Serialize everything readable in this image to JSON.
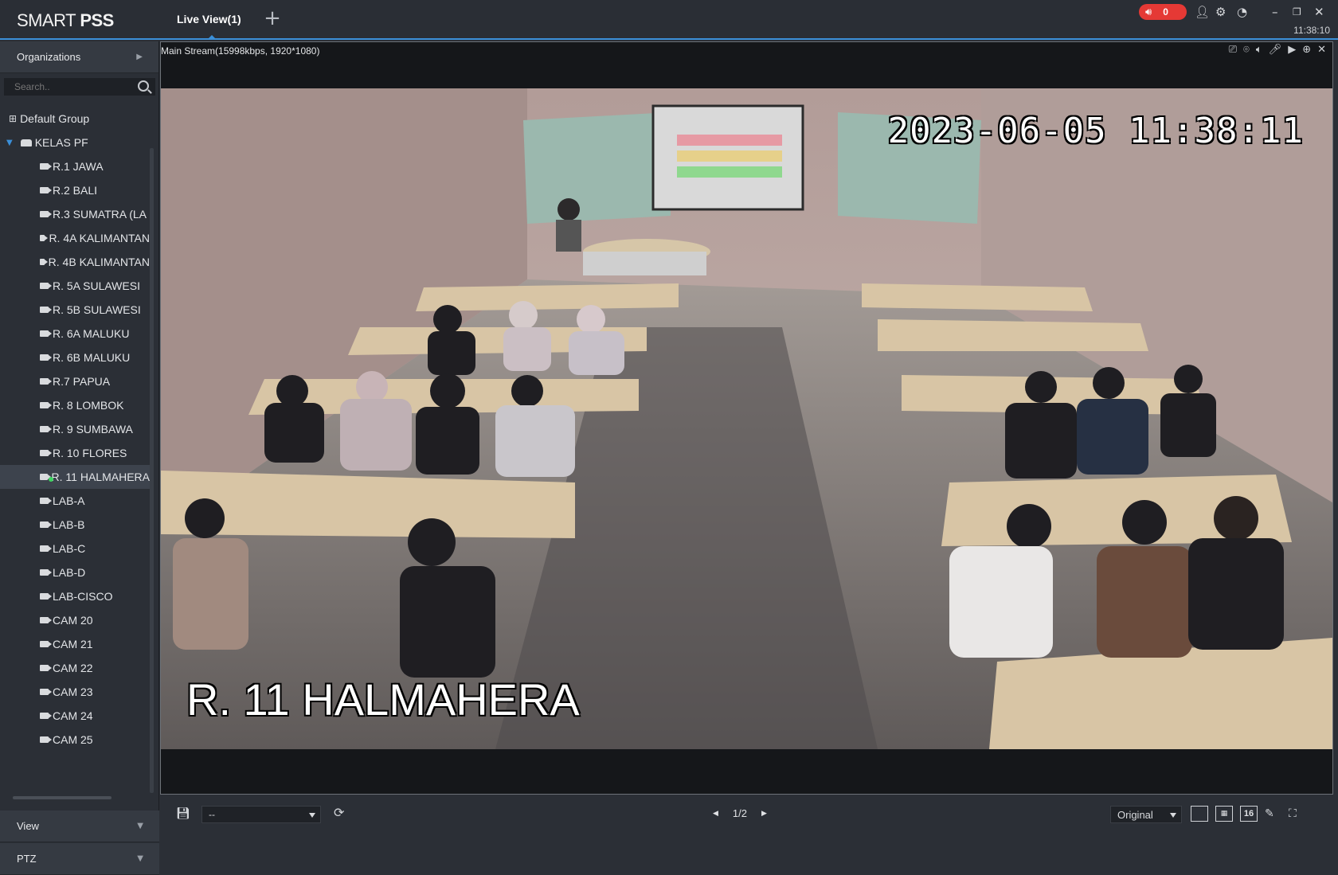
{
  "app": {
    "logo_light": "SMART ",
    "logo_bold": "PSS",
    "clock": "11:38:10"
  },
  "tabs": [
    {
      "label": "Live View(1)"
    }
  ],
  "alarm": {
    "count": "0"
  },
  "sidebar": {
    "organizations_label": "Organizations",
    "search_placeholder": "Search..",
    "root": "Default Group",
    "group": "KELAS PF",
    "devices": [
      "R.1 JAWA",
      "R.2 BALI",
      "R.3 SUMATRA (LA",
      "R. 4A KALIMANTAN",
      "R. 4B KALIMANTAN",
      "R. 5A SULAWESI",
      "R. 5B SULAWESI",
      "R. 6A MALUKU",
      "R. 6B MALUKU",
      "R.7 PAPUA",
      "R. 8 LOMBOK",
      "R. 9 SUMBAWA",
      "R. 10 FLORES",
      "R. 11 HALMAHERA",
      "LAB-A",
      "LAB-B",
      "LAB-C",
      "LAB-D",
      "LAB-CISCO",
      "CAM 20",
      "CAM 21",
      "CAM 22",
      "CAM 23",
      "CAM 24",
      "CAM 25"
    ],
    "selected_device": "R. 11 HALMAHERA",
    "view_label": "View",
    "ptz_label": "PTZ"
  },
  "video": {
    "stream_info": "Main Stream(15998kbps, 1920*1080)",
    "osd_timestamp": "2023-06-05 11:38:11",
    "osd_camera_name": "R. 11 HALMAHERA"
  },
  "bottombar": {
    "preset_value": "--",
    "page": "1/2",
    "ratio_value": "Original",
    "layout_16_label": "16"
  },
  "colors": {
    "accent": "#3b8fd8",
    "alarm": "#e53935",
    "live_dot": "#3ed461"
  }
}
